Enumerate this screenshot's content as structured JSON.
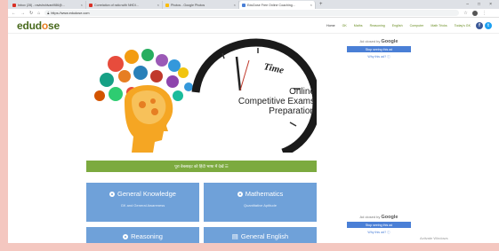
{
  "browser": {
    "tabs": [
      {
        "label": "Inbox (28) - ravishshivani986@...",
        "color": "#d93025",
        "active": false
      },
      {
        "label": "Correlation of ratio with NHDI...",
        "color": "#d93025",
        "active": false
      },
      {
        "label": "Photos - Google Photos",
        "color": "#fbbc04",
        "active": false
      },
      {
        "label": "EduDose Free Online Coaching...",
        "color": "#4a7fd6",
        "active": true
      }
    ],
    "url": "https://www.edudose.com"
  },
  "site": {
    "logo_prefix": "edud",
    "logo_o": "o",
    "logo_suffix": "se",
    "menu": [
      "Home",
      "GK",
      "Maths",
      "Reasoning",
      "English",
      "Computer",
      "Math Tricks",
      "Today's GK"
    ]
  },
  "hero": {
    "clock_word": "Time",
    "line1": "Online",
    "line2": "Competitive Exams",
    "line3": "Preparation"
  },
  "ads": {
    "top": {
      "ads_by": "Ad closed by",
      "google": "Google",
      "stop": "Stop seeing this ad",
      "why": "Why this ad? ⓘ"
    },
    "bottom": {
      "ads_by": "Ad closed by",
      "google": "Google",
      "stop": "Stop seeing this ad",
      "why": "Why this ad? ⓘ"
    }
  },
  "hindi_bar": "पूरा वेबसाइट को हिंदी भाषा में देखें ☰",
  "cards": {
    "gk": {
      "title": "General Knowledge",
      "sub": "GK and General Awareness"
    },
    "maths": {
      "title": "Mathematics",
      "sub": "Quantitative Aptitude"
    },
    "reasoning": {
      "title": "Reasoning",
      "sub": ""
    },
    "english": {
      "title": "General English",
      "sub": ""
    }
  },
  "watermark": "Activate Windows"
}
